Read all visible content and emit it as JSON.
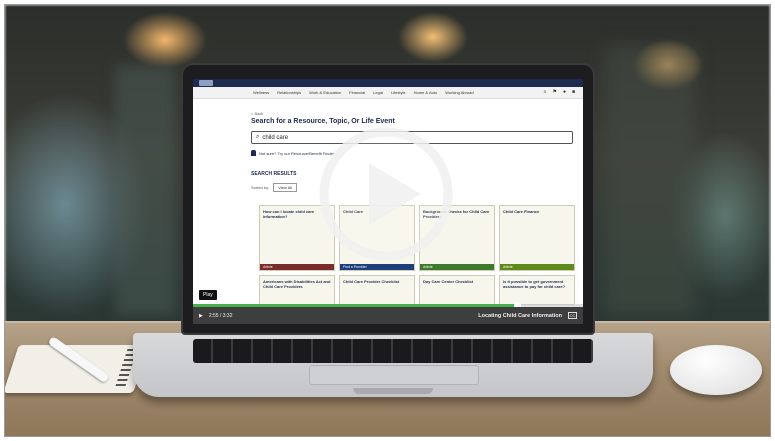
{
  "site": {
    "nav_items": [
      "Wellness",
      "Relationships",
      "Work & Education",
      "Financial",
      "Legal",
      "Lifestyle",
      "Home & Auto",
      "Working Abroad"
    ],
    "back_link": "< Back",
    "heading": "Search for a Resource, Topic, Or Life Event",
    "search_value": "child care",
    "tip": "Not sure? Try our Resource/Benefit Finder",
    "results_heading": "SEARCH RESULTS",
    "filter_label": "Sorted by:",
    "filter_value": "View All",
    "cards": [
      {
        "title": "How can I locate child care information?",
        "tag": "Article",
        "tag_color": "#7a2b2b"
      },
      {
        "title": "Child Care",
        "tag": "Find a Provider",
        "tag_color": "#1d3f7a"
      },
      {
        "title": "Background Checks for Child Care Providers",
        "tag": "Article",
        "tag_color": "#3f7a2b"
      },
      {
        "title": "Child Care Finance",
        "tag": "Article",
        "tag_color": "#5e8a1a"
      }
    ],
    "cards_row2": [
      "Americans with Disabilities Act and Child Care Providers",
      "Child Care Provider Checklist",
      "Day Care Center Checklist",
      "Is it possible to get government assistance to pay for child care?"
    ]
  },
  "player": {
    "play_tooltip": "Play",
    "time": "2:55 / 3:32",
    "video_title": "Locating Child Care Information",
    "cc_label": "CC",
    "progress": 0.83,
    "accent": "#47b04b"
  }
}
